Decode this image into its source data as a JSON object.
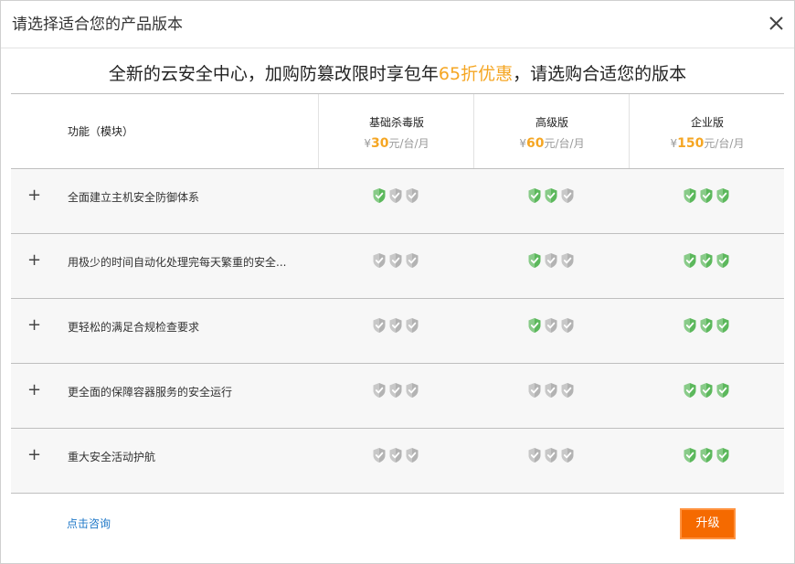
{
  "dialog": {
    "title": "请选择适合您的产品版本",
    "close_icon": "close-icon"
  },
  "promo": {
    "text_before": "全新的云安全中心，加购防篡改限时享包年",
    "highlight": "65折优惠",
    "text_after": "，请选购合适您的版本",
    "highlight_color": "#f5a623"
  },
  "table": {
    "feature_header": "功能（模块）",
    "plans": [
      {
        "name": "基础杀毒版",
        "currency": "¥",
        "price": "30",
        "unit": "元/台/月"
      },
      {
        "name": "高级版",
        "currency": "¥",
        "price": "60",
        "unit": "元/台/月"
      },
      {
        "name": "企业版",
        "currency": "¥",
        "price": "150",
        "unit": "元/台/月"
      }
    ],
    "rows": [
      {
        "expand": "+",
        "feature": "全面建立主机安全防御体系",
        "levels": [
          1,
          2,
          3
        ]
      },
      {
        "expand": "+",
        "feature": "用极少的时间自动化处理完每天繁重的安全...",
        "levels": [
          0,
          1,
          3
        ]
      },
      {
        "expand": "+",
        "feature": "更轻松的满足合规检查要求",
        "levels": [
          0,
          1,
          3
        ]
      },
      {
        "expand": "+",
        "feature": "更全面的保障容器服务的安全运行",
        "levels": [
          0,
          0,
          3
        ]
      },
      {
        "expand": "+",
        "feature": "重大安全活动护航",
        "levels": [
          0,
          0,
          3
        ]
      }
    ],
    "shield_icon": "shield-check-icon",
    "shield_on_color": "#5cb85c",
    "shield_off_color": "#b3b3b3"
  },
  "footer": {
    "consult_label": "点击咨询",
    "upgrade_label": "升级",
    "upgrade_color": "#f56a00"
  }
}
